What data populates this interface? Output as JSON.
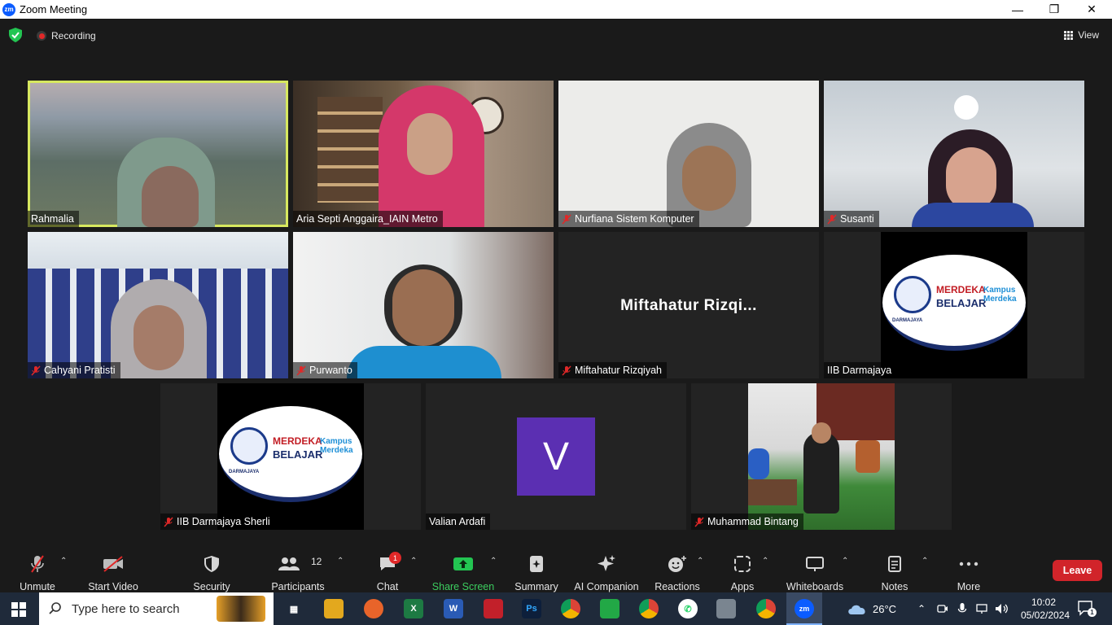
{
  "window": {
    "title": "Zoom Meeting",
    "app_icon": "zm"
  },
  "topbar": {
    "recording_label": "Recording",
    "view_label": "View"
  },
  "participants": [
    {
      "name": "Rahmalia",
      "muted": false,
      "active_speaker": true
    },
    {
      "name": "Aria Septi Anggaira_IAIN Metro",
      "muted": false
    },
    {
      "name": "Nurfiana Sistem Komputer",
      "muted": true
    },
    {
      "name": "Susanti",
      "muted": true
    },
    {
      "name": "Cahyani Pratisti",
      "muted": true
    },
    {
      "name": "Purwanto",
      "muted": true
    },
    {
      "name": "Miftahatur Rizqiyah",
      "muted": true,
      "display_name": "Miftahatur  Rizqi..."
    },
    {
      "name": "IIB Darmajaya",
      "muted": false
    },
    {
      "name": "IIB Darmajaya Sherli",
      "muted": true
    },
    {
      "name": "Valian Ardafi",
      "muted": false,
      "avatar_letter": "V"
    },
    {
      "name": "Muhammad Bintang",
      "muted": true
    }
  ],
  "logo": {
    "line1": "MERDEKA",
    "line2": "BELAJAR",
    "kampus1": "Kampus",
    "kampus2": "Merdeka",
    "org": "DARMAJAYA"
  },
  "toolbar": {
    "unmute": "Unmute",
    "start_video": "Start Video",
    "security": "Security",
    "participants": "Participants",
    "participants_count": "12",
    "chat": "Chat",
    "chat_badge": "1",
    "share_screen": "Share Screen",
    "summary": "Summary",
    "ai_companion": "AI Companion",
    "reactions": "Reactions",
    "apps": "Apps",
    "whiteboards": "Whiteboards",
    "notes": "Notes",
    "more": "More",
    "leave": "Leave"
  },
  "taskbar": {
    "search_placeholder": "Type here to search",
    "weather": "26°C",
    "time": "10:02",
    "date": "05/02/2024",
    "notifications": "1"
  },
  "colors": {
    "active_border": "#d7e85f",
    "leave": "#d1242a",
    "share_green": "#3ccd5f",
    "avatar_purple": "#5b2fb2"
  }
}
